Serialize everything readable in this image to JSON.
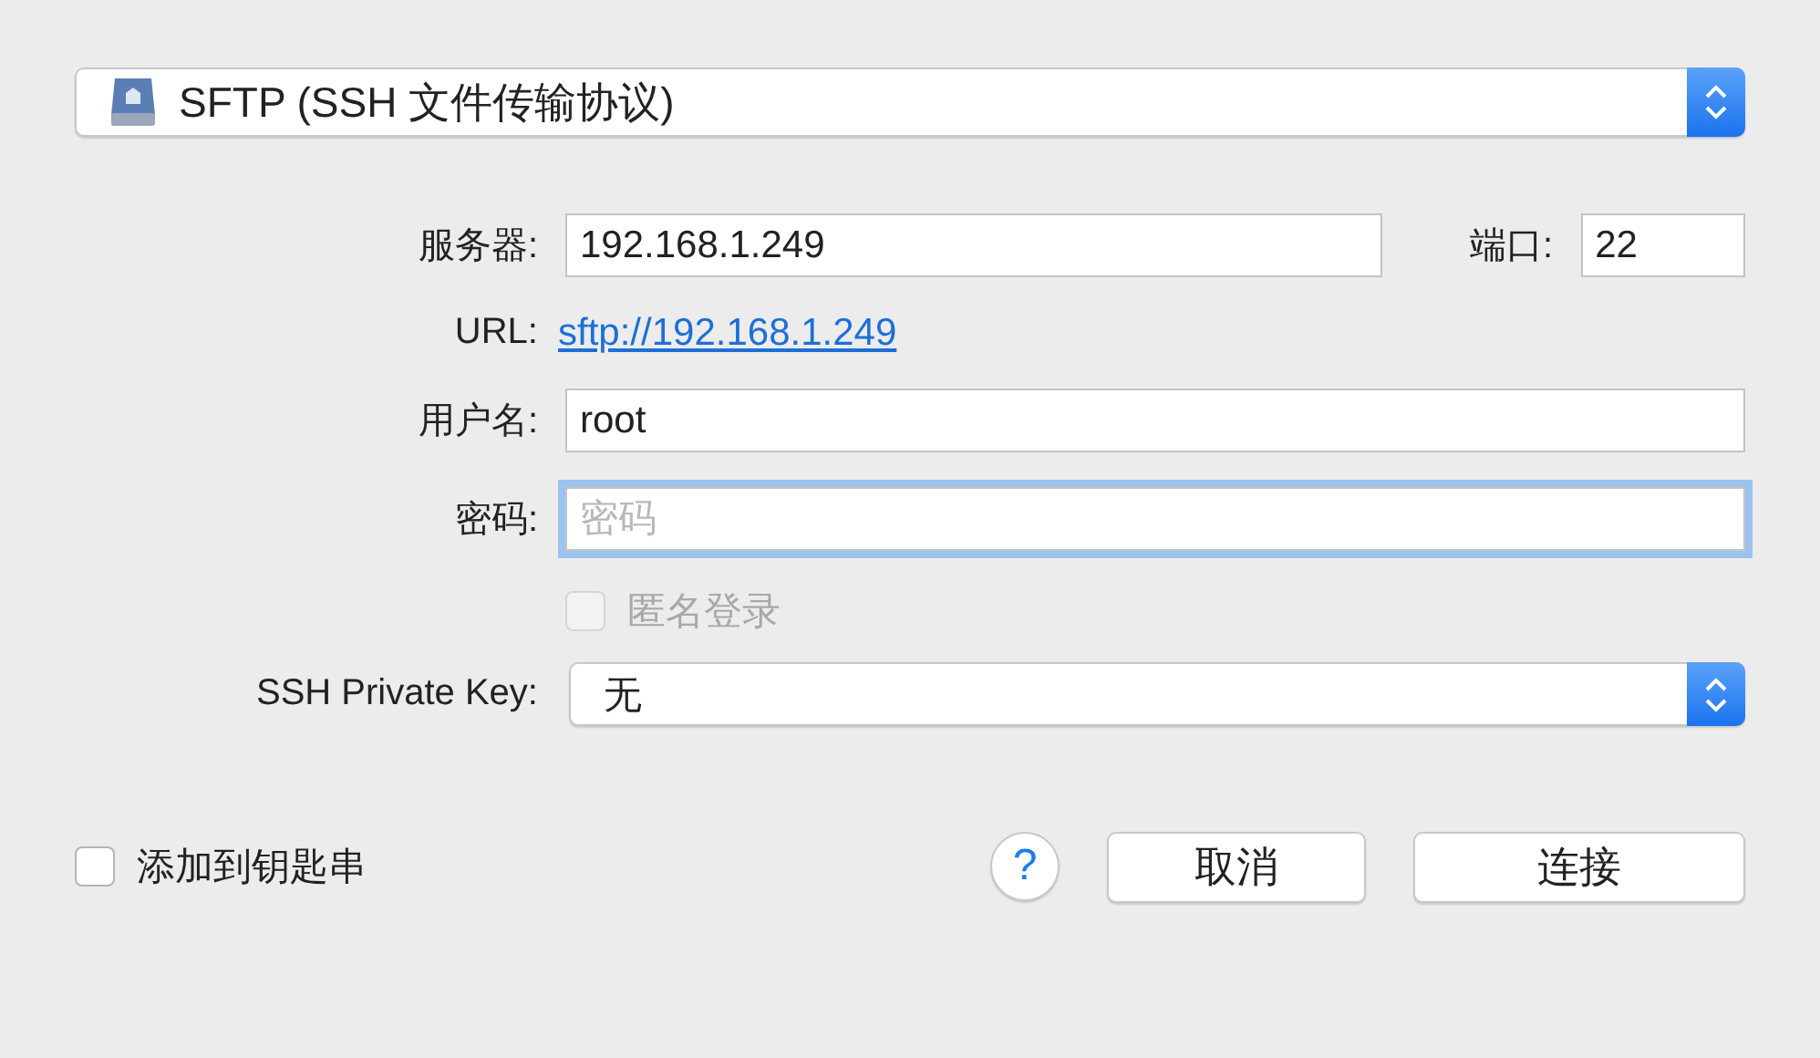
{
  "protocol": {
    "value": "SFTP (SSH 文件传输协议)"
  },
  "server": {
    "label": "服务器:",
    "value": "192.168.1.249"
  },
  "port": {
    "label": "端口:",
    "value": "22"
  },
  "url": {
    "label": "URL:",
    "link": "sftp://192.168.1.249"
  },
  "username": {
    "label": "用户名:",
    "value": "root"
  },
  "password": {
    "label": "密码:",
    "placeholder": "密码",
    "focused": true
  },
  "anonymous": {
    "label": "匿名登录",
    "checked": false,
    "disabled": true
  },
  "private_key": {
    "label": "SSH Private Key:",
    "value": "无"
  },
  "keychain": {
    "label": "添加到钥匙串",
    "checked": false
  },
  "help": {
    "label": "?"
  },
  "buttons": [
    {
      "label": "取消"
    },
    {
      "label": "连接"
    }
  ]
}
